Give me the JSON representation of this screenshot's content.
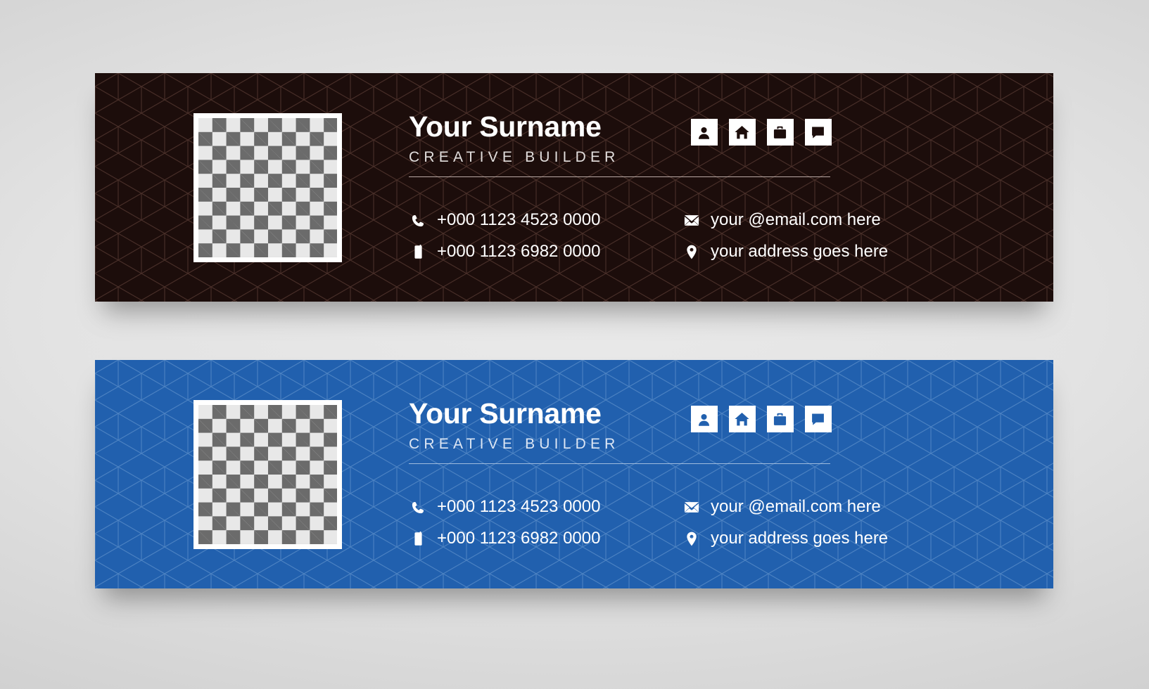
{
  "page": {
    "background_color": "#e3e3e3"
  },
  "banners": [
    {
      "variant": "dark",
      "background_color": "#1c0d0b",
      "accent_color": "#ffffff",
      "divider_color": "#b9a9a5",
      "photo_placeholder": "checkerboard-image-placeholder",
      "name": "Your Surname",
      "role": "CREATIVE BUILDER",
      "socials": [
        {
          "icon": "person-icon",
          "label": "person"
        },
        {
          "icon": "home-icon",
          "label": "home"
        },
        {
          "icon": "briefcase-icon",
          "label": "briefcase"
        },
        {
          "icon": "chat-bubble-icon",
          "label": "chat"
        }
      ],
      "contacts": {
        "left": [
          {
            "icon": "phone-icon",
            "text": "+000 1123 4523 0000"
          },
          {
            "icon": "mobile-icon",
            "text": "+000 1123 6982 0000"
          }
        ],
        "right": [
          {
            "icon": "envelope-icon",
            "text": "your @email.com here"
          },
          {
            "icon": "location-pin-icon",
            "text": "your address goes here"
          }
        ]
      }
    },
    {
      "variant": "blue",
      "background_color": "#2160ae",
      "accent_color": "#ffffff",
      "divider_color": "#9fbbdd",
      "photo_placeholder": "checkerboard-image-placeholder",
      "name": "Your Surname",
      "role": "CREATIVE BUILDER",
      "socials": [
        {
          "icon": "person-icon",
          "label": "person"
        },
        {
          "icon": "home-icon",
          "label": "home"
        },
        {
          "icon": "briefcase-icon",
          "label": "briefcase"
        },
        {
          "icon": "chat-bubble-icon",
          "label": "chat"
        }
      ],
      "contacts": {
        "left": [
          {
            "icon": "phone-icon",
            "text": "+000 1123 4523 0000"
          },
          {
            "icon": "mobile-icon",
            "text": "+000 1123 6982 0000"
          }
        ],
        "right": [
          {
            "icon": "envelope-icon",
            "text": "your @email.com here"
          },
          {
            "icon": "location-pin-icon",
            "text": "your address goes here"
          }
        ]
      }
    }
  ]
}
